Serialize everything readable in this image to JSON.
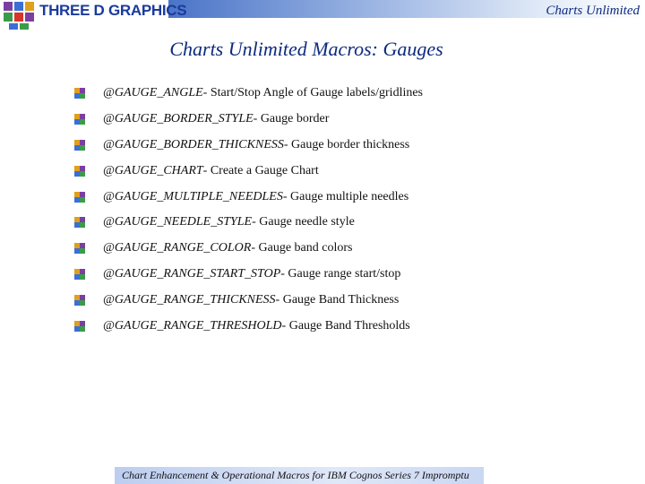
{
  "header": {
    "logo_text": "THREE D GRAPHICS",
    "right_title": "Charts Unlimited"
  },
  "slide": {
    "title": "Charts Unlimited Macros: Gauges",
    "items": [
      {
        "macro": "@GAUGE_ANGLE",
        "desc": " - Start/Stop Angle of Gauge labels/gridlines"
      },
      {
        "macro": "@GAUGE_BORDER_STYLE",
        "desc": " - Gauge border"
      },
      {
        "macro": "@GAUGE_BORDER_THICKNESS",
        "desc": " - Gauge border thickness"
      },
      {
        "macro": "@GAUGE_CHART",
        "desc": " - Create a Gauge Chart"
      },
      {
        "macro": "@GAUGE_MULTIPLE_NEEDLES",
        "desc": " - Gauge multiple needles"
      },
      {
        "macro": "@GAUGE_NEEDLE_STYLE",
        "desc": " - Gauge needle style"
      },
      {
        "macro": "@GAUGE_RANGE_COLOR",
        "desc": " - Gauge band colors"
      },
      {
        "macro": "@GAUGE_RANGE_START_STOP",
        "desc": " - Gauge range start/stop"
      },
      {
        "macro": "@GAUGE_RANGE_THICKNESS",
        "desc": " - Gauge Band Thickness"
      },
      {
        "macro": "@GAUGE_RANGE_THRESHOLD",
        "desc": " - Gauge Band Thresholds"
      }
    ]
  },
  "footer": {
    "text": "Chart Enhancement & Operational Macros for IBM Cognos Series 7 Impromptu"
  },
  "icons": {
    "logo": "three-d-graphics-logo-icon",
    "bullet": "bullet-icon"
  },
  "colors": {
    "title": "#0d2b7e",
    "logo_text": "#1a3a9c",
    "header_band": "#4b74c8",
    "footer_band": "#bccdf0"
  }
}
